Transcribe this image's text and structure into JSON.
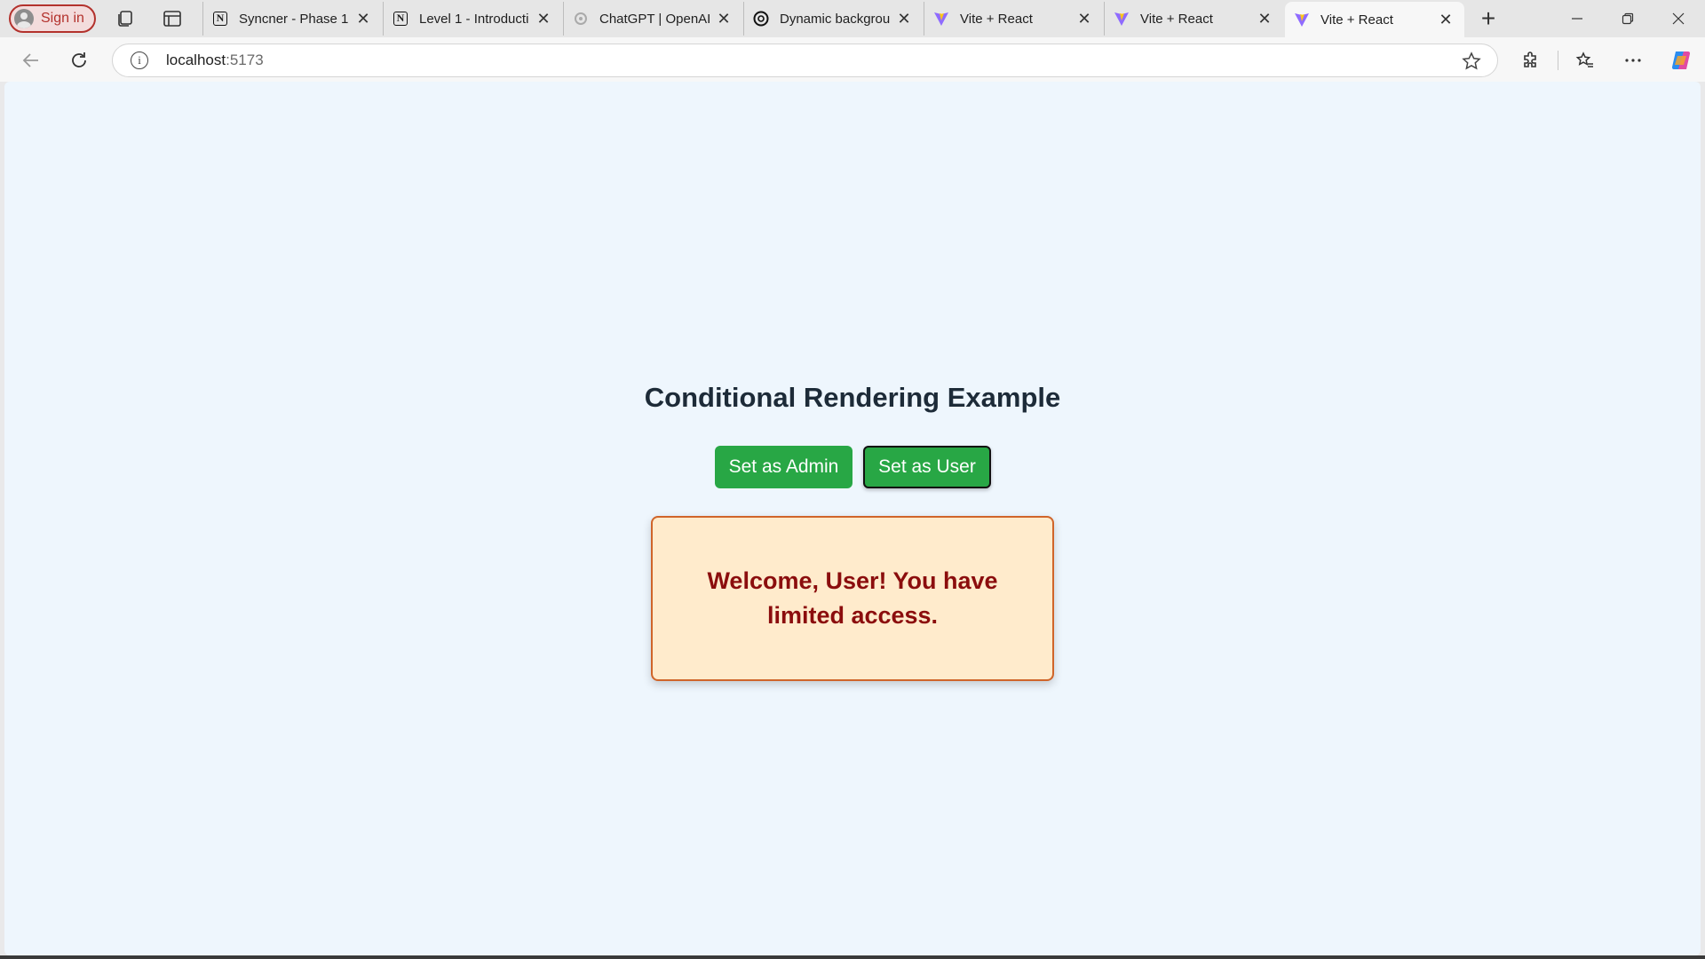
{
  "browser": {
    "signin_label": "Sign in",
    "tabs": [
      {
        "title": "Syncner - Phase 1",
        "favicon": "notion-icon"
      },
      {
        "title": "Level 1 - Introducti",
        "favicon": "notion-icon"
      },
      {
        "title": "ChatGPT | OpenAI",
        "favicon": "openai-icon"
      },
      {
        "title": "Dynamic backgrou",
        "favicon": "openai-icon"
      },
      {
        "title": "Vite + React",
        "favicon": "vite-icon"
      },
      {
        "title": "Vite + React",
        "favicon": "vite-icon"
      },
      {
        "title": "Vite + React",
        "favicon": "vite-icon",
        "active": true
      }
    ],
    "address": {
      "host": "localhost",
      "port": ":5173"
    }
  },
  "page": {
    "title": "Conditional Rendering Example",
    "buttons": {
      "admin_label": "Set as Admin",
      "user_label": "Set as User"
    },
    "message": "Welcome, User! You have limited access."
  },
  "colors": {
    "background": "#eef6fd",
    "button_green": "#28a745",
    "message_bg": "#ffebcc",
    "message_border": "#d0652a",
    "message_text": "#8b0d0d"
  }
}
